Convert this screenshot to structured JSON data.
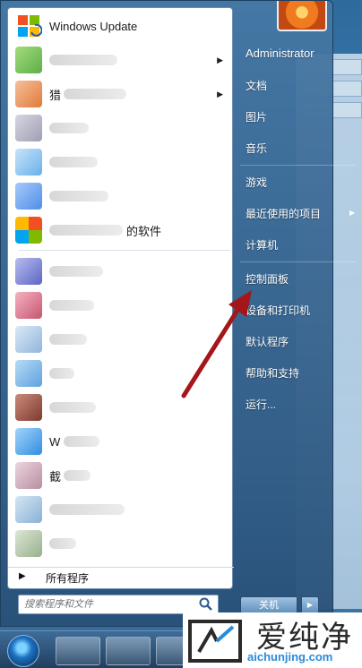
{
  "left_pane": {
    "items": [
      {
        "label": "Windows Update",
        "has_submenu": false,
        "icon": "windows-update-icon",
        "icon_color": "#3a8fd8"
      },
      {
        "label": "",
        "has_submenu": true,
        "icon": "app-icon",
        "icon_color": "#7ec45a"
      },
      {
        "label": "猎",
        "has_submenu": true,
        "icon": "app-icon",
        "icon_color": "#f0a060"
      },
      {
        "label": "",
        "has_submenu": false,
        "icon": "app-icon",
        "icon_color": "#b9b9c9"
      },
      {
        "label": "",
        "has_submenu": false,
        "icon": "app-icon",
        "icon_color": "#8fc7f0"
      },
      {
        "label": "",
        "has_submenu": false,
        "icon": "app-icon",
        "icon_color": "#6fa8ee"
      },
      {
        "label": "的软件",
        "has_submenu": false,
        "icon": "app-icon",
        "icon_color": "#7ac86a"
      },
      {
        "label": "",
        "has_submenu": false,
        "icon": "app-icon",
        "icon_color": "#7b84d0"
      },
      {
        "label": "",
        "has_submenu": false,
        "icon": "app-icon",
        "icon_color": "#d7728a"
      },
      {
        "label": "",
        "has_submenu": false,
        "icon": "app-icon",
        "icon_color": "#9fc2e4"
      },
      {
        "label": "",
        "has_submenu": false,
        "icon": "app-icon",
        "icon_color": "#7fb6e8"
      },
      {
        "label": "",
        "has_submenu": false,
        "icon": "app-icon",
        "icon_color": "#a65a4a"
      },
      {
        "label": "W",
        "has_submenu": false,
        "icon": "app-icon",
        "icon_color": "#4ea8f0"
      },
      {
        "label": "截",
        "has_submenu": false,
        "icon": "app-icon",
        "icon_color": "#c9a9b9"
      },
      {
        "label": "",
        "has_submenu": false,
        "icon": "app-icon",
        "icon_color": "#a9c8e8"
      },
      {
        "label": "",
        "has_submenu": false,
        "icon": "app-icon",
        "icon_color": "#b0c4a8"
      }
    ],
    "all_programs": "所有程序",
    "search_placeholder": "搜索程序和文件"
  },
  "right_pane": {
    "items": [
      "Administrator",
      "文档",
      "图片",
      "音乐",
      "游戏",
      "最近使用的项目",
      "计算机",
      "控制面板",
      "设备和打印机",
      "默认程序",
      "帮助和支持",
      "运行..."
    ],
    "shutdown_label": "关机"
  },
  "watermark": {
    "cn": "爱纯净",
    "url": "aichunjing.com"
  },
  "colors": {
    "annotation_arrow": "#a4161a",
    "menu_blue": "#3f6e9c"
  }
}
